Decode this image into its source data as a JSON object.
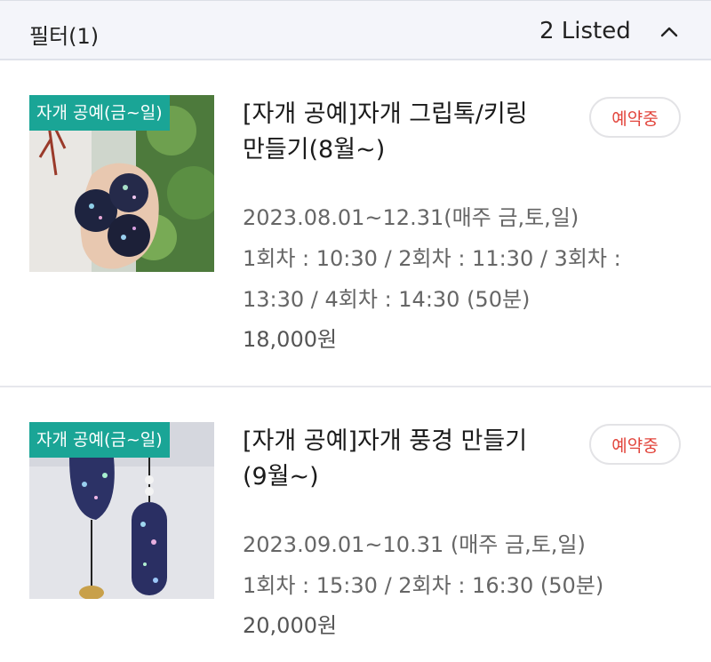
{
  "filter_bar": {
    "filter_label": "필터(1)",
    "listed_count": "2 Listed"
  },
  "colors": {
    "badge_bg": "#1aa596",
    "status_text": "#e2453c",
    "filter_bar_bg": "#f4f5fa"
  },
  "icons": {
    "toggle": "chevron-up-icon"
  },
  "items": [
    {
      "category": "자개 공예(금~일)",
      "title_line1": "[자개 공예]자개 그립톡/키링",
      "title_line2": "만들기(8월~)",
      "status": "예약중",
      "period": "2023.08.01~12.31(매주 금,토,일)",
      "schedule_line1": "1회차 : 10:30 / 2회차 : 11:30 / 3회차 :",
      "schedule_line2": "13:30 / 4회차 : 14:30 (50분)",
      "price": "18,000원"
    },
    {
      "category": "자개 공예(금~일)",
      "title_line1": "[자개 공예]자개 풍경 만들기",
      "title_line2": "(9월~)",
      "status": "예약중",
      "period": "2023.09.01~10.31 (매주 금,토,일)",
      "schedule_line1": "1회차 : 15:30 / 2회차 : 16:30 (50분)",
      "price": "20,000원"
    }
  ]
}
